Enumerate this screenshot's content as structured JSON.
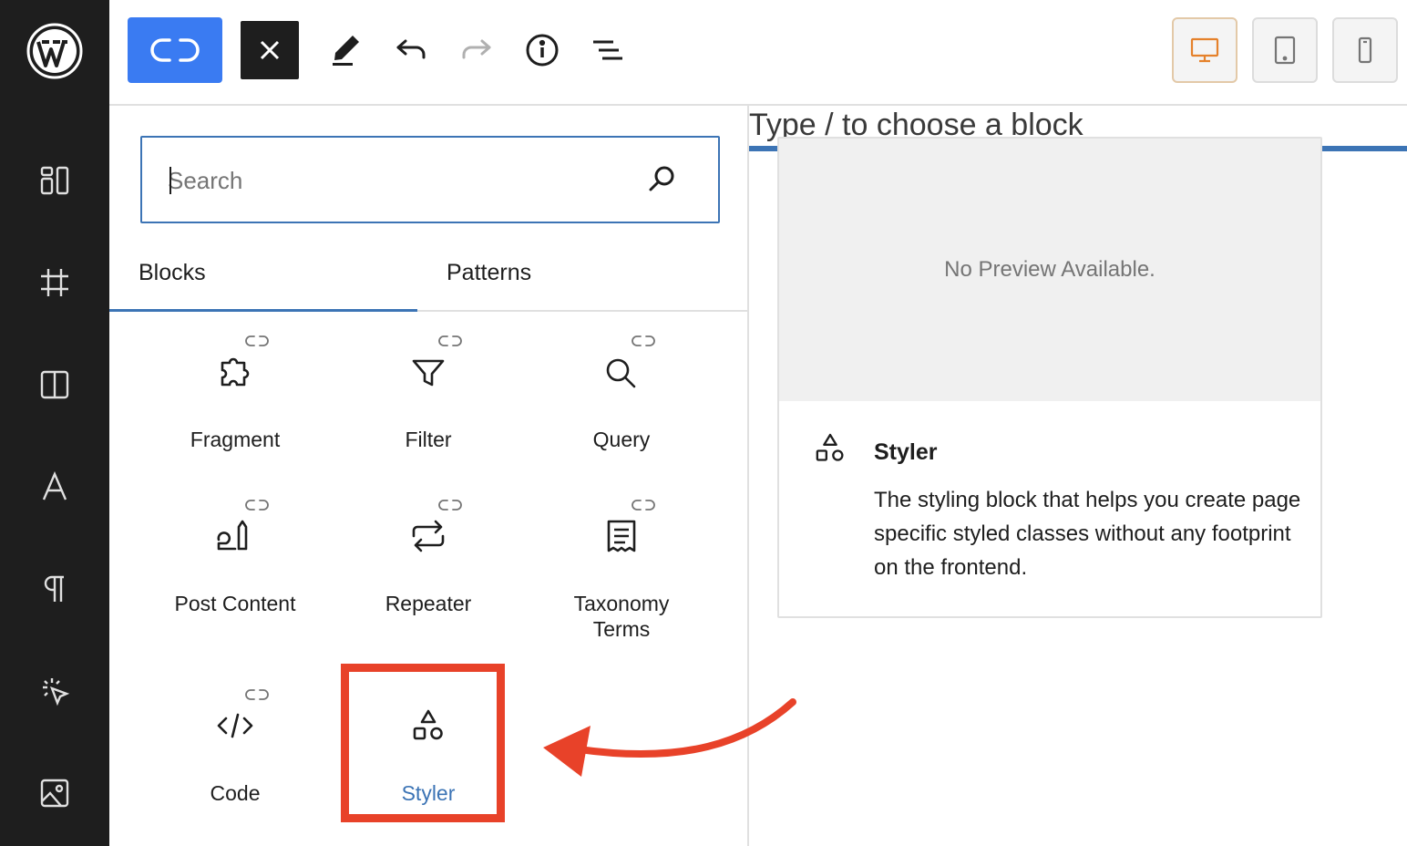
{
  "toolbar": {
    "inserter_toggle_icon": "link-icon",
    "close_icon": "close-icon",
    "tools": [
      "edit-pencil-icon",
      "undo-icon",
      "redo-icon",
      "info-icon",
      "list-view-icon"
    ],
    "devices": [
      "desktop-icon",
      "tablet-icon",
      "mobile-icon"
    ],
    "accent_color": "#3a7bf2",
    "active_device_color": "#e5812b"
  },
  "sidebar": {
    "items": [
      "wordpress-logo",
      "layout-icon",
      "grid-icon",
      "columns-icon",
      "typography-icon",
      "paragraph-icon",
      "interaction-icon",
      "media-icon"
    ]
  },
  "search": {
    "placeholder": "Search"
  },
  "tabs": [
    {
      "label": "Blocks",
      "active": true
    },
    {
      "label": "Patterns",
      "active": false
    }
  ],
  "blocks": [
    {
      "label": "Fragment",
      "icon": "puzzle-icon"
    },
    {
      "label": "Filter",
      "icon": "filter-icon"
    },
    {
      "label": "Query",
      "icon": "search-icon"
    },
    {
      "label": "Post Content",
      "icon": "post-content-icon"
    },
    {
      "label": "Repeater",
      "icon": "repeat-icon"
    },
    {
      "label": "Taxonomy Terms",
      "icon": "receipt-icon"
    },
    {
      "label": "Code",
      "icon": "code-icon"
    },
    {
      "label": "Styler",
      "icon": "shapes-icon"
    }
  ],
  "canvas": {
    "placeholder": "Type / to choose a block"
  },
  "preview": {
    "no_preview": "No Preview Available.",
    "title": "Styler",
    "description": "The styling block that helps you create page specific styled classes without any footprint on the frontend."
  },
  "highlight_color": "#e84229"
}
